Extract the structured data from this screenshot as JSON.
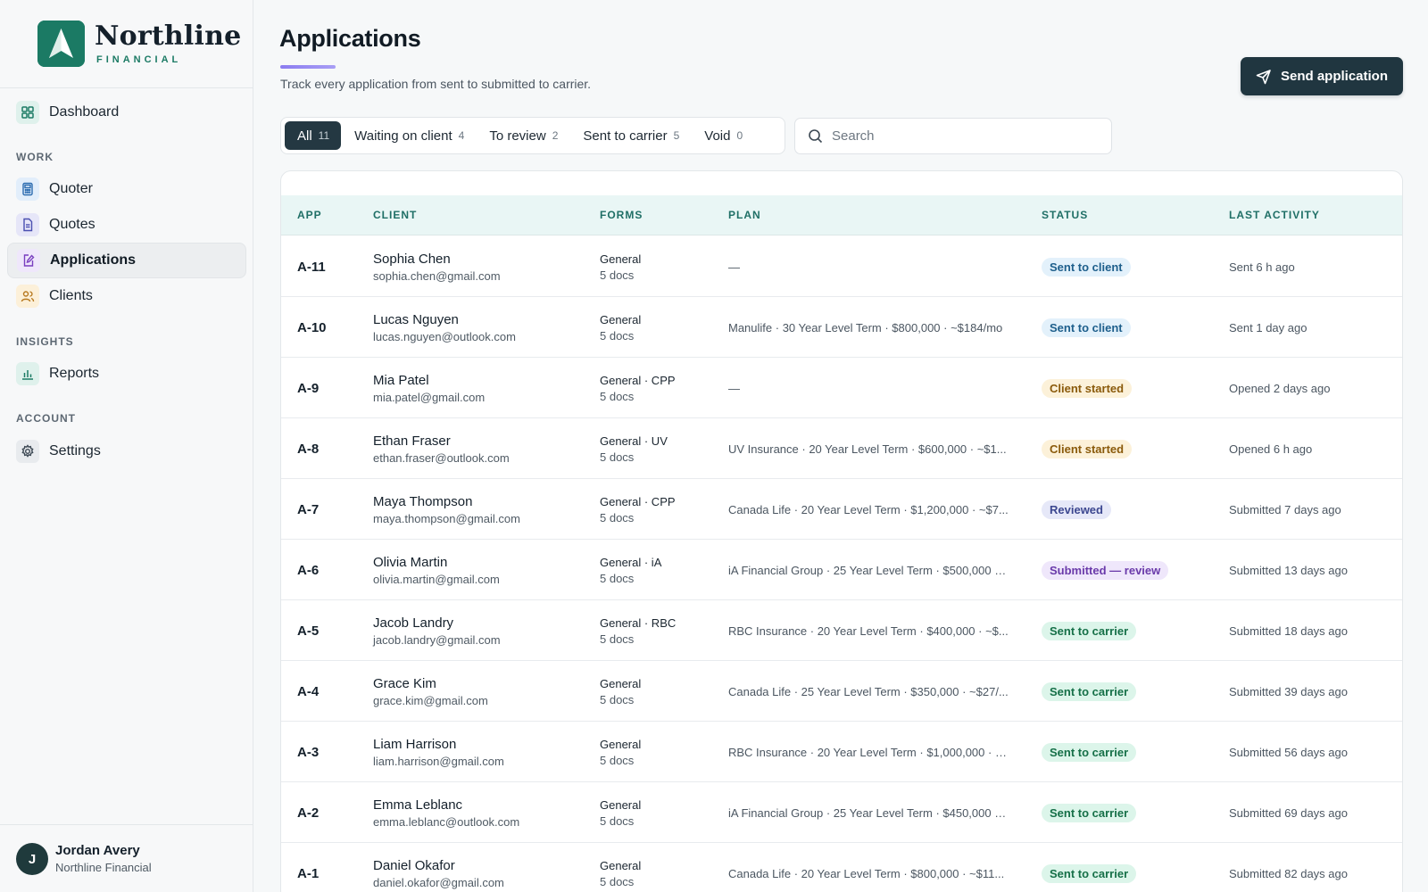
{
  "brand": {
    "name": "Northline",
    "sub": "FINANCIAL",
    "color": "#1b7a64"
  },
  "sidebar": {
    "dashboard": "Dashboard",
    "work_label": "WORK",
    "quoter": "Quoter",
    "quotes": "Quotes",
    "applications": "Applications",
    "clients": "Clients",
    "insights_label": "INSIGHTS",
    "reports": "Reports",
    "account_label": "ACCOUNT",
    "settings": "Settings"
  },
  "user": {
    "initial": "J",
    "name": "Jordan Avery",
    "org": "Northline Financial"
  },
  "page": {
    "title": "Applications",
    "subtitle": "Track every application from sent to submitted to carrier.",
    "send_button": "Send application"
  },
  "tabs": [
    {
      "label": "All",
      "count": "11"
    },
    {
      "label": "Waiting on client",
      "count": "4"
    },
    {
      "label": "To review",
      "count": "2"
    },
    {
      "label": "Sent to carrier",
      "count": "5"
    },
    {
      "label": "Void",
      "count": "0"
    }
  ],
  "search": {
    "placeholder": "Search",
    "value": ""
  },
  "table": {
    "headers": {
      "app": "APP",
      "client": "CLIENT",
      "forms": "FORMS",
      "plan": "PLAN",
      "status": "STATUS",
      "activity": "LAST ACTIVITY"
    },
    "rows": [
      {
        "app": "A-11",
        "name": "Sophia Chen",
        "email": "sophia.chen@gmail.com",
        "forms": "General",
        "docs": "5 docs",
        "plan": "—",
        "status": "Sent to client",
        "activity": "Sent 6 h ago"
      },
      {
        "app": "A-10",
        "name": "Lucas Nguyen",
        "email": "lucas.nguyen@outlook.com",
        "forms": "General",
        "docs": "5 docs",
        "plan": "Manulife · 30 Year Level Term · $800,000 · ~$184/mo",
        "status": "Sent to client",
        "activity": "Sent 1 day ago"
      },
      {
        "app": "A-9",
        "name": "Mia Patel",
        "email": "mia.patel@gmail.com",
        "forms": "General · CPP",
        "docs": "5 docs",
        "plan": "—",
        "status": "Client started",
        "activity": "Opened 2 days ago"
      },
      {
        "app": "A-8",
        "name": "Ethan Fraser",
        "email": "ethan.fraser@outlook.com",
        "forms": "General · UV",
        "docs": "5 docs",
        "plan": "UV Insurance · 20 Year Level Term · $600,000 · ~$1...",
        "status": "Client started",
        "activity": "Opened 6 h ago"
      },
      {
        "app": "A-7",
        "name": "Maya Thompson",
        "email": "maya.thompson@gmail.com",
        "forms": "General · CPP",
        "docs": "5 docs",
        "plan": "Canada Life · 20 Year Level Term · $1,200,000 · ~$7...",
        "status": "Reviewed",
        "activity": "Submitted 7 days ago"
      },
      {
        "app": "A-6",
        "name": "Olivia Martin",
        "email": "olivia.martin@gmail.com",
        "forms": "General · iA",
        "docs": "5 docs",
        "plan": "iA Financial Group · 25 Year Level Term · $500,000 · ...",
        "status": "Submitted — review",
        "activity": "Submitted 13 days ago"
      },
      {
        "app": "A-5",
        "name": "Jacob Landry",
        "email": "jacob.landry@gmail.com",
        "forms": "General · RBC",
        "docs": "5 docs",
        "plan": "RBC Insurance · 20 Year Level Term · $400,000 · ~$...",
        "status": "Sent to carrier",
        "activity": "Submitted 18 days ago"
      },
      {
        "app": "A-4",
        "name": "Grace Kim",
        "email": "grace.kim@gmail.com",
        "forms": "General",
        "docs": "5 docs",
        "plan": "Canada Life · 25 Year Level Term · $350,000 · ~$27/...",
        "status": "Sent to carrier",
        "activity": "Submitted 39 days ago"
      },
      {
        "app": "A-3",
        "name": "Liam Harrison",
        "email": "liam.harrison@gmail.com",
        "forms": "General",
        "docs": "5 docs",
        "plan": "RBC Insurance · 20 Year Level Term · $1,000,000 · ~...",
        "status": "Sent to carrier",
        "activity": "Submitted 56 days ago"
      },
      {
        "app": "A-2",
        "name": "Emma Leblanc",
        "email": "emma.leblanc@outlook.com",
        "forms": "General",
        "docs": "5 docs",
        "plan": "iA Financial Group · 25 Year Level Term · $450,000 · ...",
        "status": "Sent to carrier",
        "activity": "Submitted 69 days ago"
      },
      {
        "app": "A-1",
        "name": "Daniel Okafor",
        "email": "daniel.okafor@gmail.com",
        "forms": "General",
        "docs": "5 docs",
        "plan": "Canada Life · 20 Year Level Term · $800,000 · ~$11...",
        "status": "Sent to carrier",
        "activity": "Submitted 82 days ago"
      }
    ]
  },
  "colors": {
    "accent": "#243842",
    "header_bg": "#e9f6f5",
    "header_text": "#1f6f66"
  }
}
